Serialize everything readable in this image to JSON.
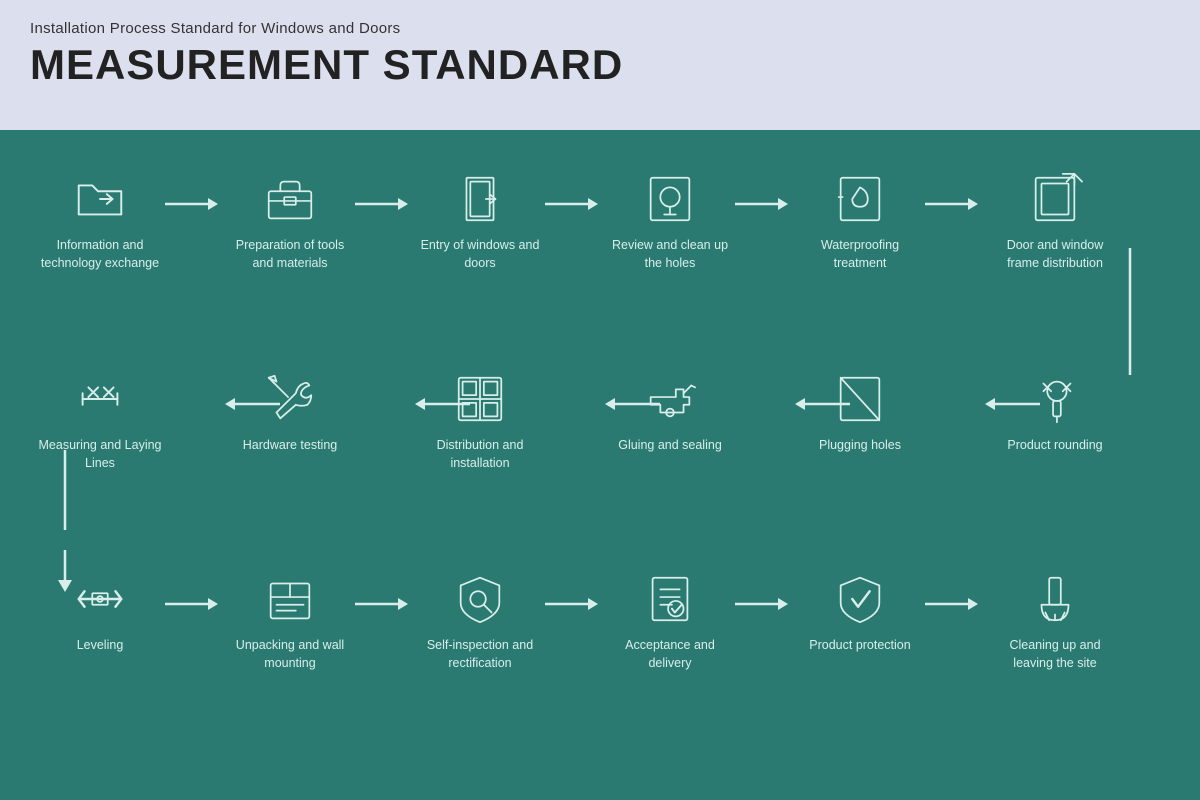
{
  "header": {
    "subtitle": "Installation Process Standard for Windows and Doors",
    "title": "MEASUREMENT STANDARD"
  },
  "steps": {
    "row1": [
      {
        "id": "s1",
        "label": "Information and technology exchange",
        "icon": "folder"
      },
      {
        "id": "s2",
        "label": "Preparation of tools and materials",
        "icon": "toolbox"
      },
      {
        "id": "s3",
        "label": "Entry of windows and doors",
        "icon": "door-enter"
      },
      {
        "id": "s4",
        "label": "Review and clean up the holes",
        "icon": "magnify"
      },
      {
        "id": "s5",
        "label": "Waterproofing treatment",
        "icon": "waterproof"
      },
      {
        "id": "s6",
        "label": "Door and window frame distribution",
        "icon": "frame-export"
      }
    ],
    "row2": [
      {
        "id": "s7",
        "label": "Measuring and Laying Lines",
        "icon": "measure"
      },
      {
        "id": "s8",
        "label": "Hardware testing",
        "icon": "wrench"
      },
      {
        "id": "s9",
        "label": "Distribution and installation",
        "icon": "grid-install"
      },
      {
        "id": "s10",
        "label": "Gluing and sealing",
        "icon": "glue-gun"
      },
      {
        "id": "s11",
        "label": "Plugging holes",
        "icon": "plug-holes"
      },
      {
        "id": "s12",
        "label": "Product rounding",
        "icon": "pin"
      }
    ],
    "row3": [
      {
        "id": "s13",
        "label": "Leveling",
        "icon": "level"
      },
      {
        "id": "s14",
        "label": "Unpacking and wall mounting",
        "icon": "unpack"
      },
      {
        "id": "s15",
        "label": "Self-inspection and rectification",
        "icon": "self-inspect"
      },
      {
        "id": "s16",
        "label": "Acceptance and delivery",
        "icon": "accept"
      },
      {
        "id": "s17",
        "label": "Product protection",
        "icon": "protect"
      },
      {
        "id": "s18",
        "label": "Cleaning up and leaving the site",
        "icon": "clean"
      }
    ]
  },
  "colors": {
    "bg_header": "#dce0ee",
    "bg_main": "#2a7a72",
    "icon_stroke": "#d8eeea",
    "arrow_color": "#d8eeea"
  }
}
